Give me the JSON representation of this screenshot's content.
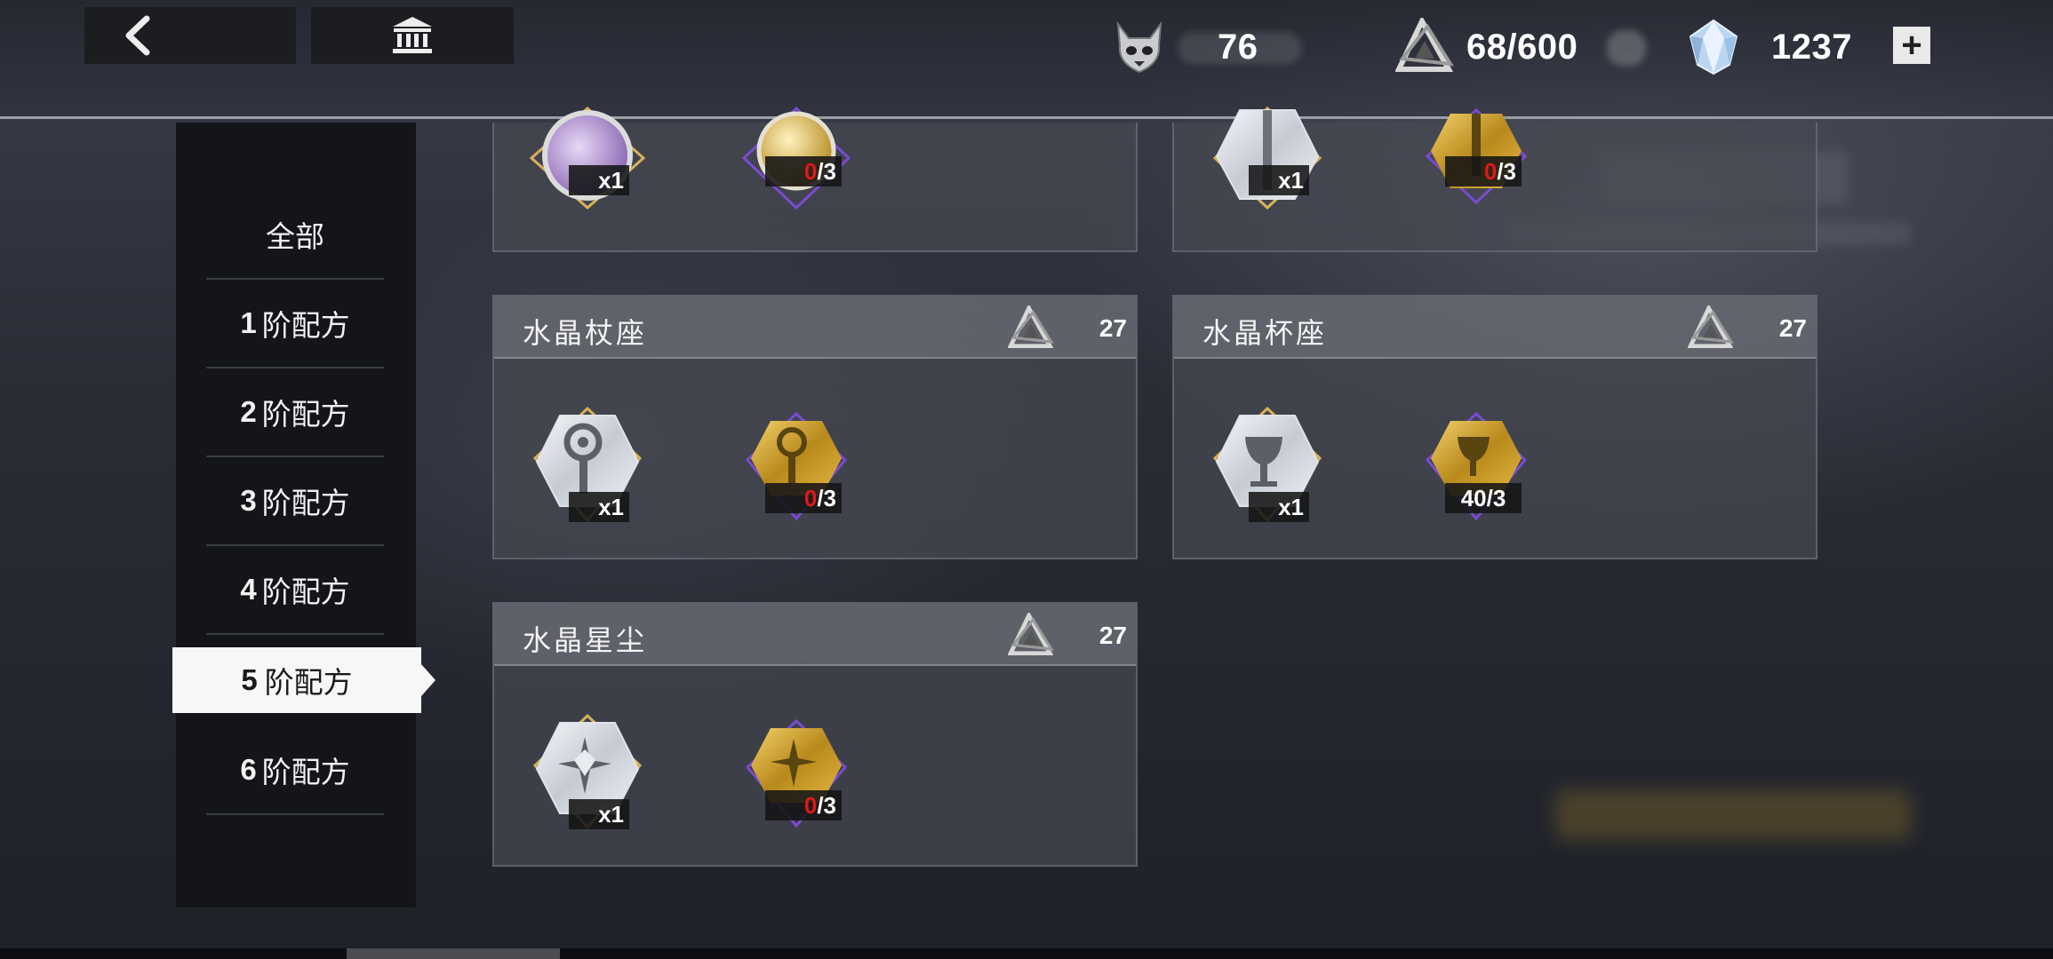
{
  "header": {
    "back_icon": "chevron-left-icon",
    "home_icon": "museum-icon",
    "resources": [
      {
        "icon": "demon-skull-icon",
        "value": "76"
      },
      {
        "icon": "triangle-star-icon",
        "value": "68/600"
      },
      {
        "icon": "crystal-gem-icon",
        "value": "1237"
      }
    ],
    "plus_label": "+"
  },
  "sidebar": {
    "all_label": "全部",
    "items": [
      {
        "num": "1",
        "label": "阶配方"
      },
      {
        "num": "2",
        "label": "阶配方"
      },
      {
        "num": "3",
        "label": "阶配方"
      },
      {
        "num": "4",
        "label": "阶配方"
      },
      {
        "num": "5",
        "label": "阶配方"
      },
      {
        "num": "6",
        "label": "阶配方"
      }
    ],
    "selected_index": 4
  },
  "cards": {
    "top_left": {
      "input_count": "x1",
      "output_red": "0",
      "output_rest": "/3"
    },
    "top_right": {
      "input_count": "x1",
      "output_red": "0",
      "output_rest": "/3"
    },
    "staff": {
      "title": "水晶杖座",
      "cost": "27",
      "input_count": "x1",
      "output_red": "0",
      "output_rest": "/3"
    },
    "cup": {
      "title": "水晶杯座",
      "cost": "27",
      "input_count": "x1",
      "output": "40/3"
    },
    "stardust": {
      "title": "水晶星尘",
      "cost": "27",
      "input_count": "x1",
      "output_red": "0",
      "output_rest": "/3"
    }
  },
  "colors": {
    "gold": "#d4a72c",
    "purple_border": "#7a4bd0",
    "gold_border": "#d9b15a",
    "red": "#e01818"
  }
}
